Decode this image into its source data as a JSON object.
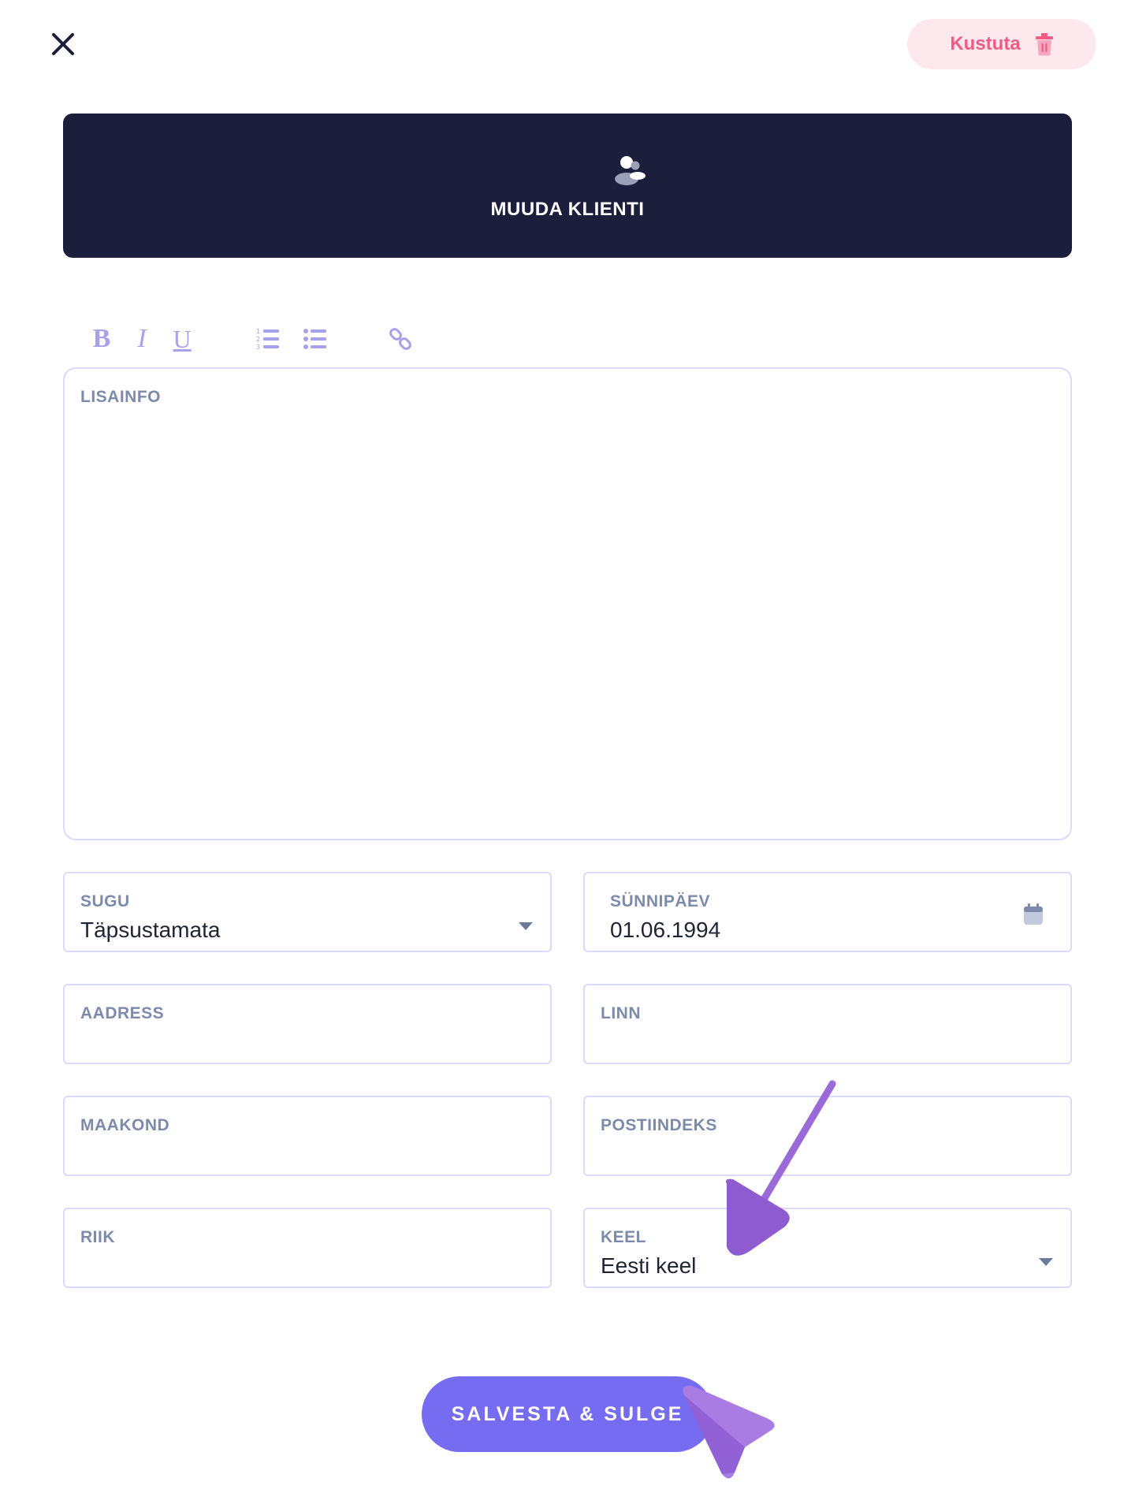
{
  "header": {
    "close_icon": "close-icon",
    "delete_label": "Kustuta",
    "delete_icon": "trash-icon",
    "card_title": "MUUDA KLIENTI",
    "card_icon": "person-icon"
  },
  "toolbar": {
    "bold": "B",
    "italic": "I",
    "underline": "U",
    "icons": [
      "ordered-list-icon",
      "bullet-list-icon",
      "link-icon"
    ]
  },
  "form": {
    "notes_label": "LISAINFO",
    "gender_label": "SUGU",
    "gender_value": "Täpsustamata",
    "birthday_label": "SÜNNIPÄEV",
    "birthday_value": "01.06.1994",
    "address_label": "AADRESS",
    "city_label": "LINN",
    "county_label": "MAAKOND",
    "postal_label": "POSTIINDEKS",
    "country_label": "RIIK",
    "language_label": "KEEL",
    "language_value": "Eesti keel"
  },
  "footer": {
    "save_label": "SALVESTA & SULGE"
  },
  "colors": {
    "header_bg": "#1c1f3c",
    "accent": "#766cf2",
    "delete_bg": "#fde8ee",
    "delete_text": "#f25b86",
    "field_border": "#dcdafa",
    "label_text": "#7c8bab",
    "pointer": "#9a6ad8"
  }
}
